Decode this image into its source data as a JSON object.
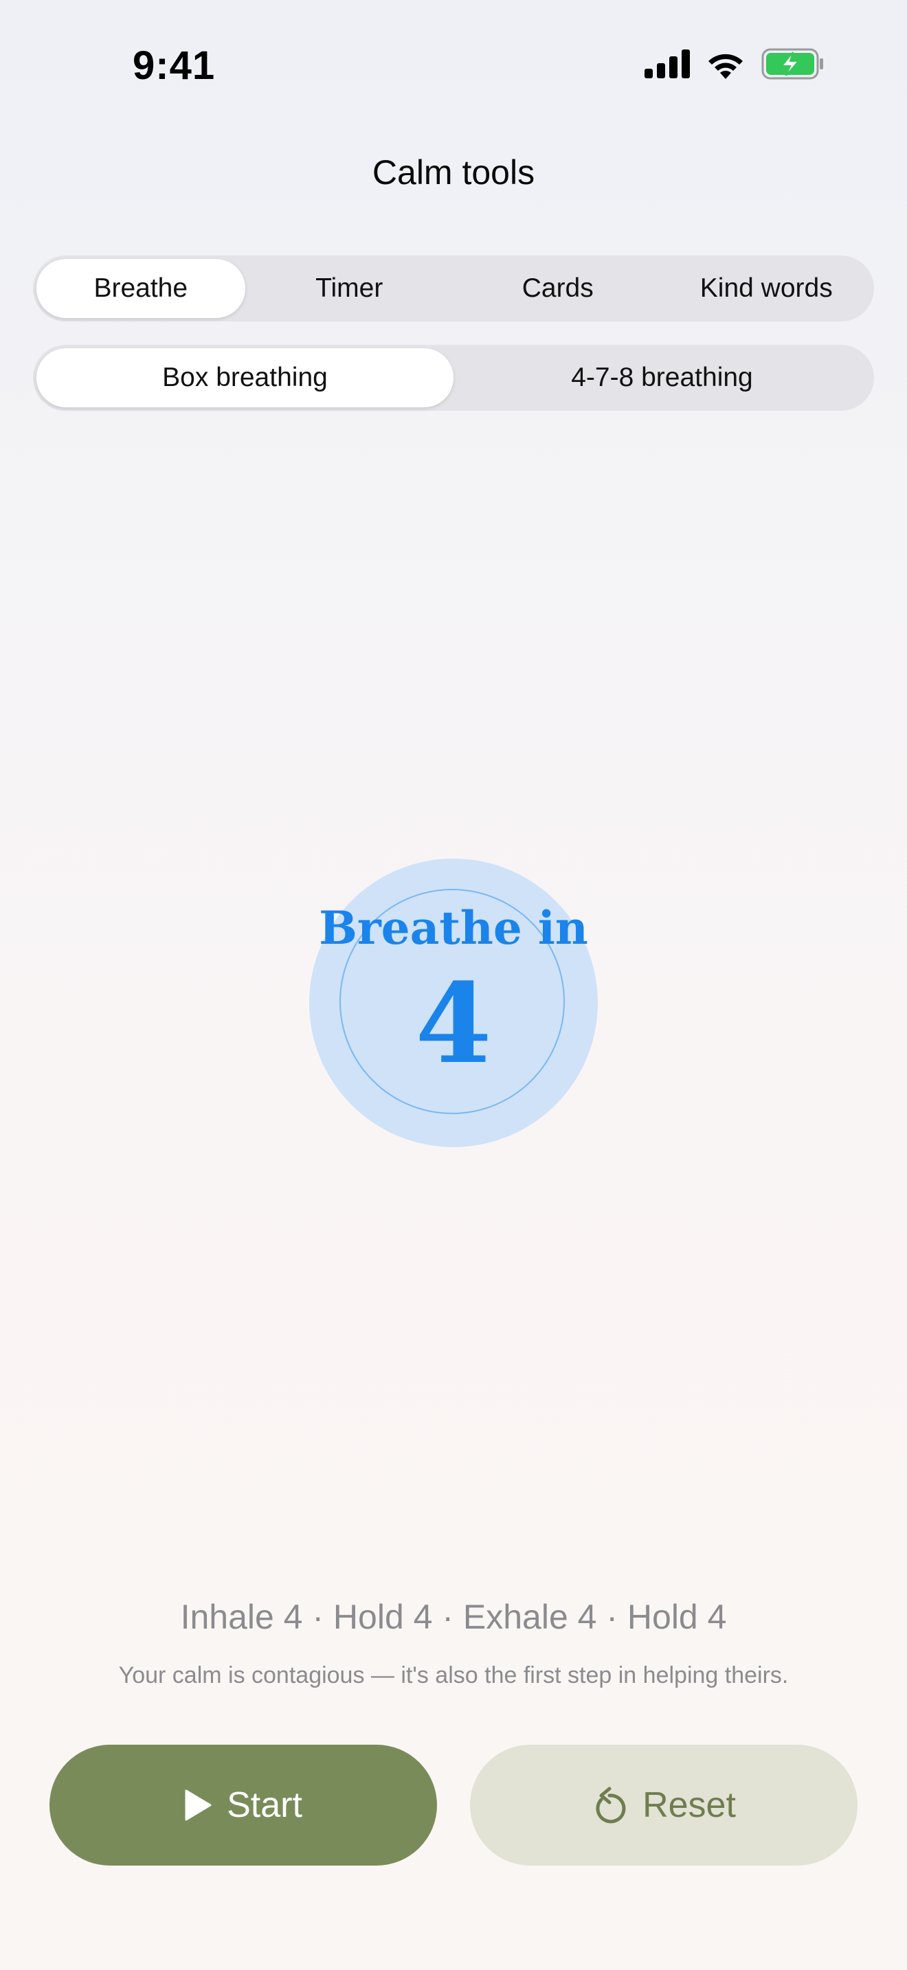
{
  "status_bar": {
    "time": "9:41",
    "icons": [
      "cellular-signal-icon",
      "wifi-icon",
      "battery-charging-icon"
    ]
  },
  "header": {
    "title": "Calm tools"
  },
  "tabs": [
    {
      "label": "Breathe",
      "active": true
    },
    {
      "label": "Timer",
      "active": false
    },
    {
      "label": "Cards",
      "active": false
    },
    {
      "label": "Kind words",
      "active": false
    }
  ],
  "breathing_modes": [
    {
      "label": "Box breathing",
      "active": true
    },
    {
      "label": "4-7-8 breathing",
      "active": false
    }
  ],
  "breath": {
    "phase": "Breathe in",
    "count": "4"
  },
  "pattern": "Inhale 4 · Hold 4 · Exhale 4 · Hold 4",
  "note": "Your calm is contagious — it's also the first step in helping theirs.",
  "controls": {
    "start_label": "Start",
    "start_icon": "play-icon",
    "reset_label": "Reset",
    "reset_icon": "reset-icon"
  },
  "colors": {
    "accent_blue": "#1a84ea",
    "circle_fill": "#cfe2f8",
    "start_button": "#7a8b5a",
    "reset_button": "#e2e2d5",
    "battery_green": "#34c759"
  }
}
